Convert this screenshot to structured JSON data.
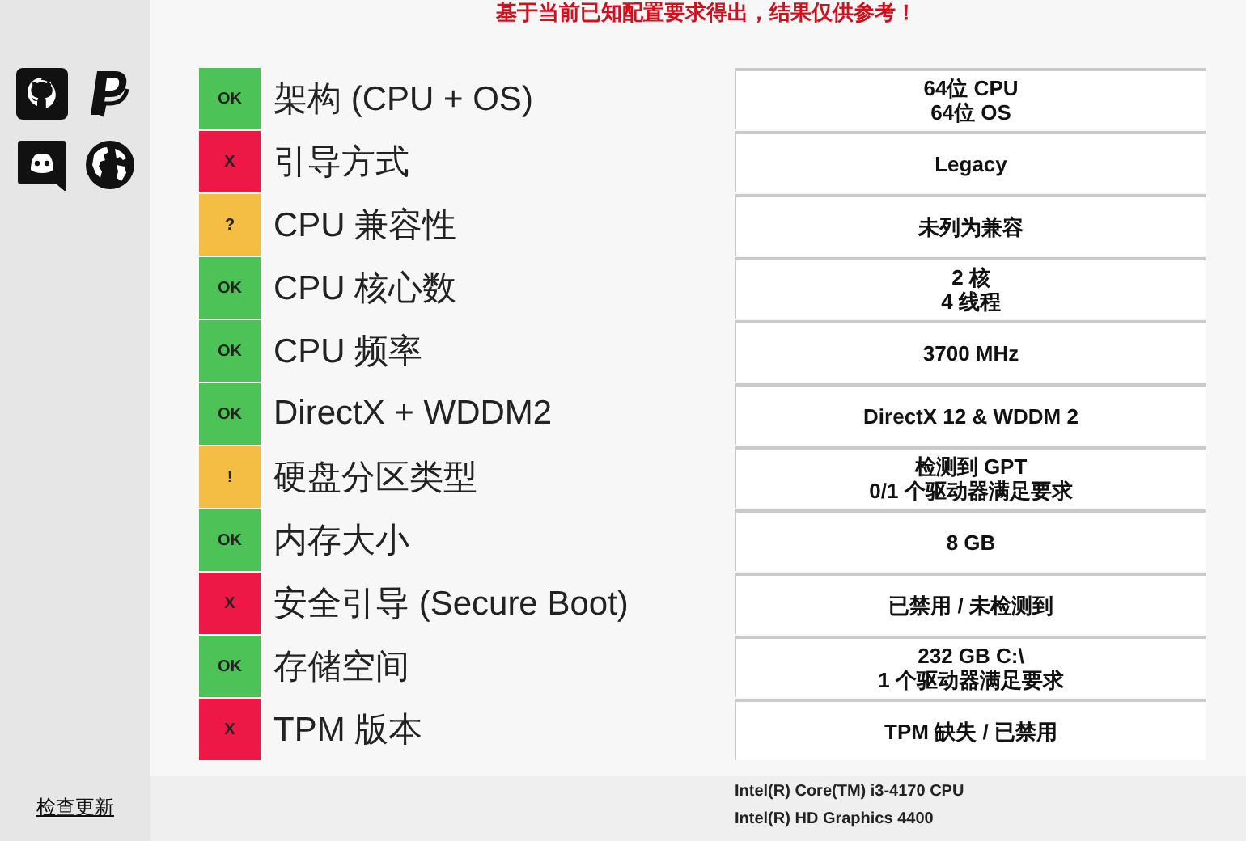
{
  "notice": "基于当前已知配置要求得出，结果仅供参考！",
  "sidebar": {
    "icons": [
      {
        "kind": "github"
      },
      {
        "kind": "paypal"
      },
      {
        "kind": "discord"
      },
      {
        "kind": "globe"
      }
    ],
    "update_link": "检查更新"
  },
  "checks": [
    {
      "color": "#4cc257",
      "badge": "OK",
      "label": "架构 (CPU + OS)",
      "value": [
        "64位 CPU",
        "64位 OS"
      ]
    },
    {
      "color": "#ee1846",
      "badge": "X",
      "label": "引导方式",
      "value": [
        "Legacy"
      ]
    },
    {
      "color": "#f4be44",
      "badge": "?",
      "label": "CPU 兼容性",
      "value": [
        "未列为兼容"
      ]
    },
    {
      "color": "#4cc257",
      "badge": "OK",
      "label": "CPU 核心数",
      "value": [
        "2 核",
        "4 线程"
      ]
    },
    {
      "color": "#4cc257",
      "badge": "OK",
      "label": "CPU 频率",
      "value": [
        "3700 MHz"
      ]
    },
    {
      "color": "#4cc257",
      "badge": "OK",
      "label": "DirectX + WDDM2",
      "value": [
        "DirectX 12 & WDDM 2"
      ]
    },
    {
      "color": "#f4be44",
      "badge": "!",
      "label": "硬盘分区类型",
      "value": [
        "检测到 GPT",
        "0/1 个驱动器满足要求"
      ]
    },
    {
      "color": "#4cc257",
      "badge": "OK",
      "label": "内存大小",
      "value": [
        "8 GB"
      ]
    },
    {
      "color": "#ee1846",
      "badge": "X",
      "label": "安全引导 (Secure Boot)",
      "value": [
        "已禁用 / 未检测到"
      ]
    },
    {
      "color": "#4cc257",
      "badge": "OK",
      "label": "存储空间",
      "value": [
        "232 GB C:\\",
        "1 个驱动器满足要求"
      ]
    },
    {
      "color": "#ee1846",
      "badge": "X",
      "label": "TPM 版本",
      "value": [
        "TPM 缺失 / 已禁用"
      ]
    }
  ],
  "footer": {
    "cpu": "Intel(R) Core(TM) i3-4170 CPU",
    "gpu": "Intel(R) HD Graphics 4400"
  }
}
